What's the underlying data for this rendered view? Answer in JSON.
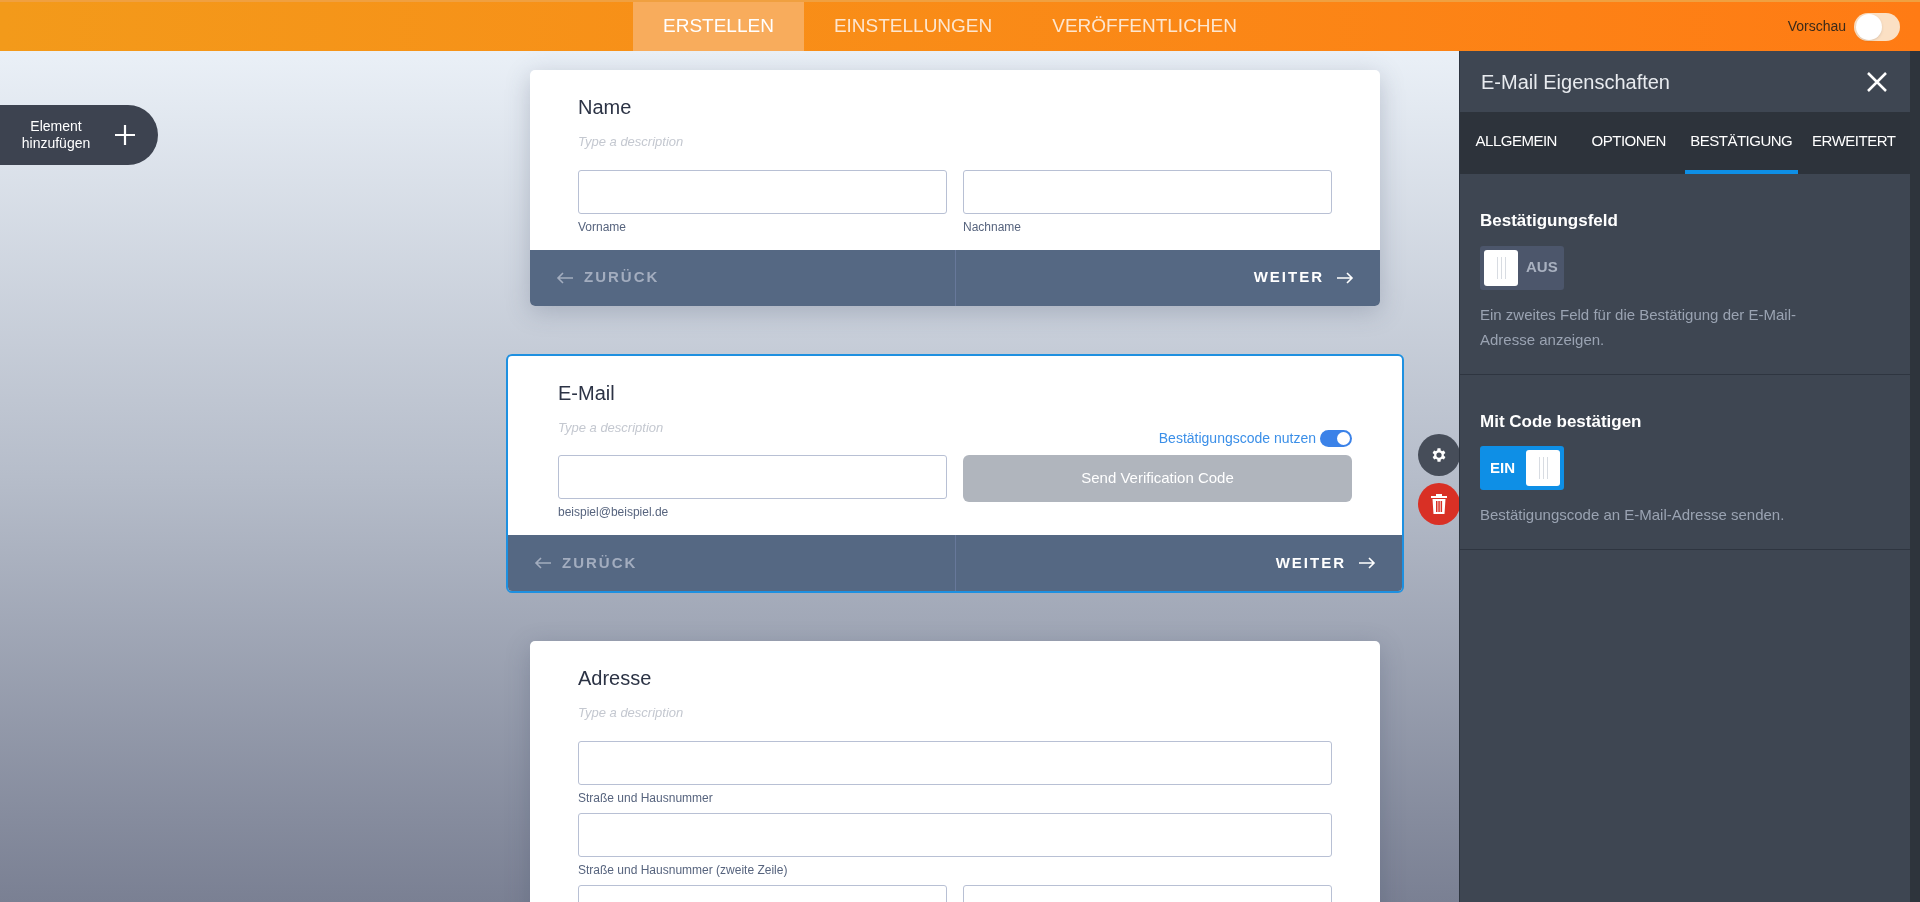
{
  "topbar": {
    "tabs": [
      {
        "label": "ERSTELLEN",
        "selected": true
      },
      {
        "label": "EINSTELLUNGEN",
        "selected": false
      },
      {
        "label": "VERÖFFENTLICHEN",
        "selected": false
      }
    ],
    "preview": {
      "label": "Vorschau",
      "on": false
    }
  },
  "add_element": {
    "label": "Element hinzufügen"
  },
  "cards": [
    {
      "title": "Name",
      "description_placeholder": "Type a description",
      "selected": false,
      "rows": [
        [
          {
            "kind": "input",
            "sublabel": "Vorname"
          },
          {
            "kind": "input",
            "sublabel": "Nachname"
          }
        ]
      ],
      "footer": {
        "back": {
          "label": "ZURÜCK",
          "disabled": true
        },
        "next": {
          "label": "WEITER",
          "disabled": false
        }
      }
    },
    {
      "title": "E-Mail",
      "description_placeholder": "Type a description",
      "selected": true,
      "verification_toggle": {
        "label": "Bestätigungscode nutzen",
        "on": true
      },
      "rows": [
        [
          {
            "kind": "input",
            "sublabel": "beispiel@beispiel.de"
          },
          {
            "kind": "button",
            "label": "Send Verification Code",
            "disabled": true
          }
        ]
      ],
      "footer": {
        "back": {
          "label": "ZURÜCK",
          "disabled": true
        },
        "next": {
          "label": "WEITER",
          "disabled": false
        }
      }
    },
    {
      "title": "Adresse",
      "description_placeholder": "Type a description",
      "selected": false,
      "rows": [
        [
          {
            "kind": "input",
            "sublabel": "Straße und Hausnummer"
          }
        ],
        [
          {
            "kind": "input",
            "sublabel": "Straße und Hausnummer (zweite Zeile)"
          }
        ],
        [
          {
            "kind": "input"
          },
          {
            "kind": "input"
          }
        ]
      ]
    }
  ],
  "panel": {
    "title": "E-Mail Eigenschaften",
    "tabs": [
      {
        "label": "ALLGEMEIN",
        "selected": false
      },
      {
        "label": "OPTIONEN",
        "selected": false
      },
      {
        "label": "BESTÄTIGUNG",
        "selected": true
      },
      {
        "label": "ERWEITERT",
        "selected": false
      }
    ],
    "sections": [
      {
        "title": "Bestätigungsfeld",
        "toggle": {
          "label": "AUS",
          "on": false
        },
        "description": "Ein zweites Feld für die Bestätigung der E-Mail-Adresse anzeigen."
      },
      {
        "title": "Mit Code bestätigen",
        "toggle": {
          "label": "EIN",
          "on": true
        },
        "description": "Bestätigungscode an E-Mail-Adresse senden."
      }
    ]
  }
}
